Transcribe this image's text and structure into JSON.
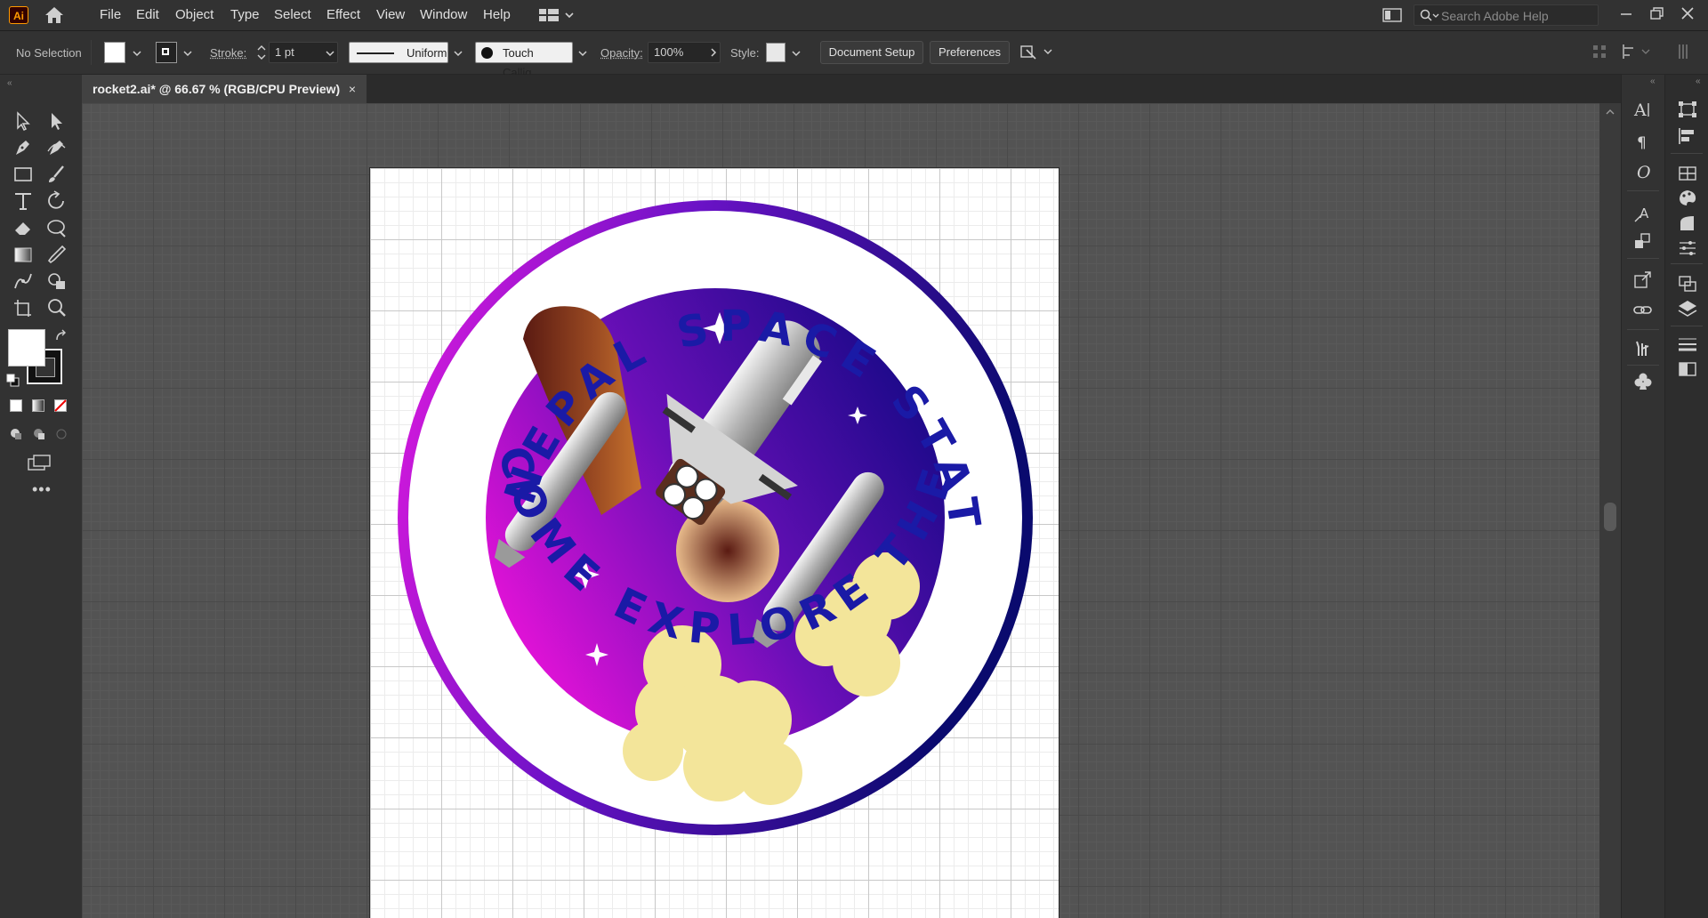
{
  "app": {
    "logo_text": "Ai"
  },
  "menu": {
    "items": [
      "File",
      "Edit",
      "Object",
      "Type",
      "Select",
      "Effect",
      "View",
      "Window",
      "Help"
    ]
  },
  "search": {
    "placeholder": "Search Adobe Help"
  },
  "control_bar": {
    "selection_status": "No Selection",
    "stroke_label": "Stroke:",
    "stroke_weight": "1 pt",
    "profile": "Uniform",
    "brush": "Touch Callig...",
    "opacity_label": "Opacity:",
    "opacity_value": "100%",
    "style_label": "Style:",
    "document_setup": "Document Setup",
    "preferences": "Preferences"
  },
  "document_tab": {
    "title": "rocket2.ai* @ 66.67 % (RGB/CPU Preview)",
    "close": "×"
  },
  "artwork": {
    "top_text": "NEPAL SPACE STATION",
    "bottom_text": "COME EXPLORE THE WORLD"
  },
  "colors": {
    "accent_text": "#1a1aa6",
    "ring_start": "#e61ae0",
    "ring_end": "#0a0a6e",
    "flame": "#f3e59a",
    "shuttle": "#c9c9c9",
    "tank": "#6b2a1d"
  }
}
